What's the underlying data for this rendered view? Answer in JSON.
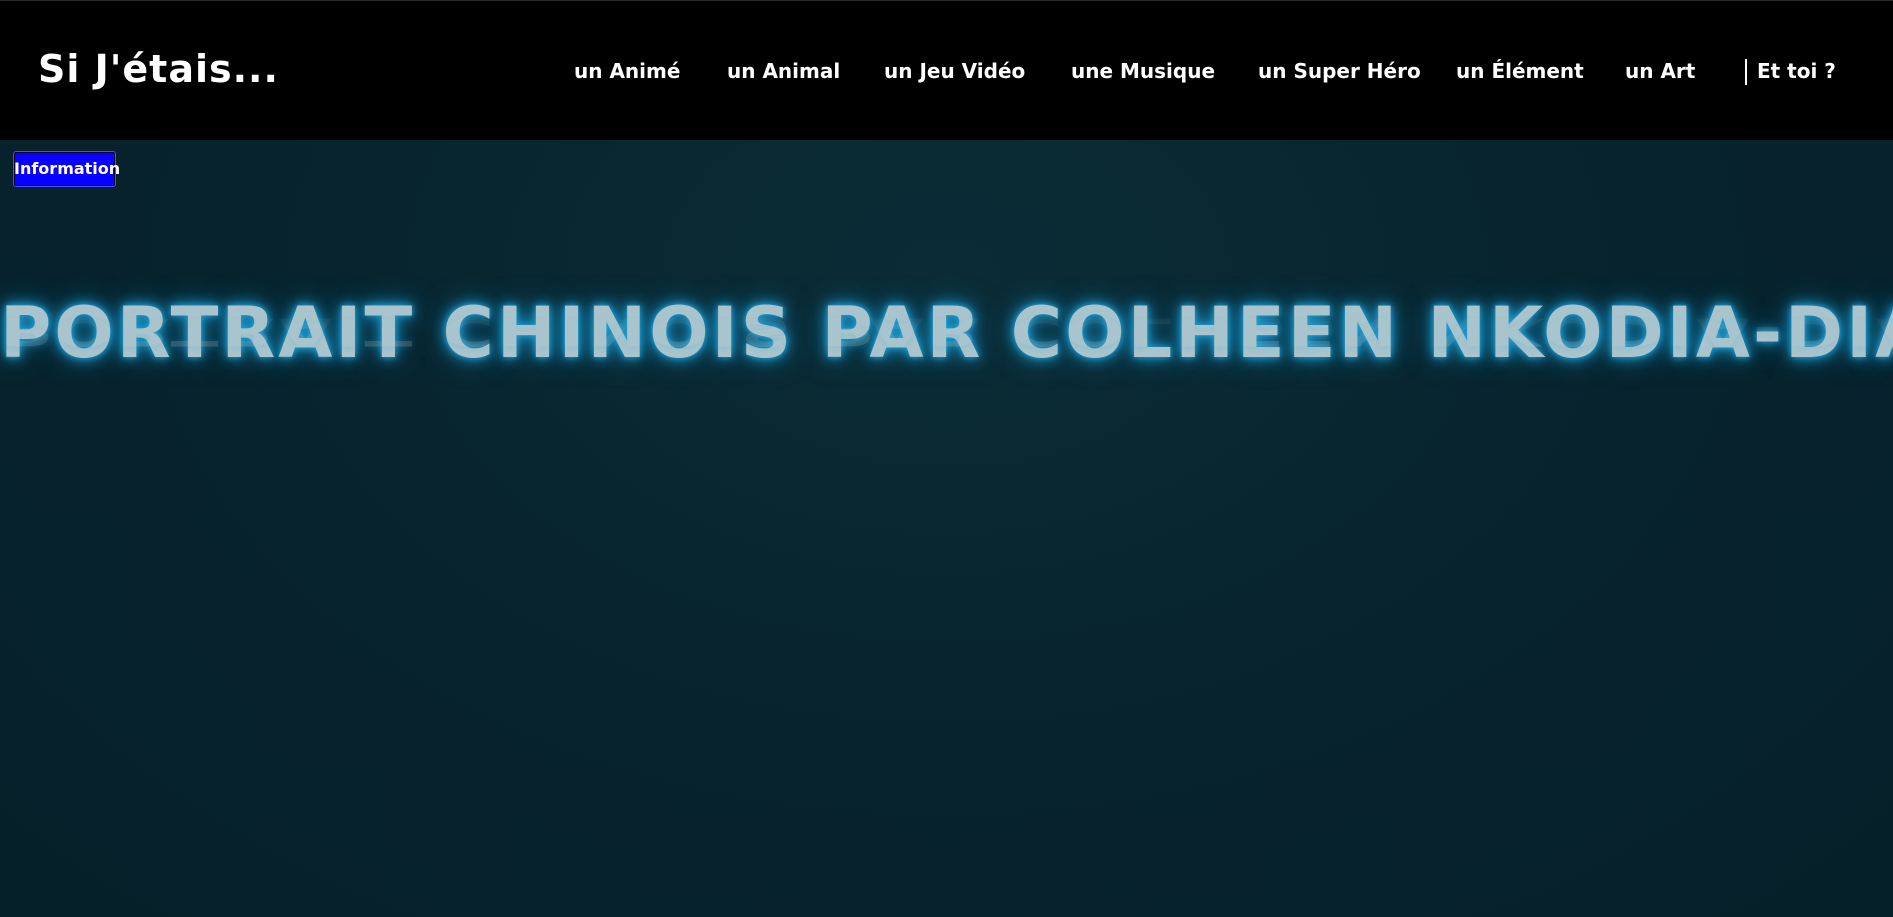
{
  "header": {
    "site_title": "Si J'étais...",
    "nav": [
      {
        "label": "un Animé"
      },
      {
        "label": "un Animal"
      },
      {
        "label": "un Jeu Vidéo"
      },
      {
        "label": "une Musique"
      },
      {
        "label": "un Super Héro"
      },
      {
        "label": "un Élément"
      },
      {
        "label": "un Art"
      },
      {
        "label": "Et toi ?"
      }
    ]
  },
  "main": {
    "info_button_label": "Information",
    "hero_title": "PORTRAIT CHINOIS PAR COLHEEN NKODIA-DIABATÉ"
  },
  "colors": {
    "topbar_bg": "#000000",
    "page_bg": "#07222c",
    "info_button_bg": "#0a00ff",
    "hero_glow": "#1e9fd6",
    "hero_text": "#a9c4cc"
  }
}
